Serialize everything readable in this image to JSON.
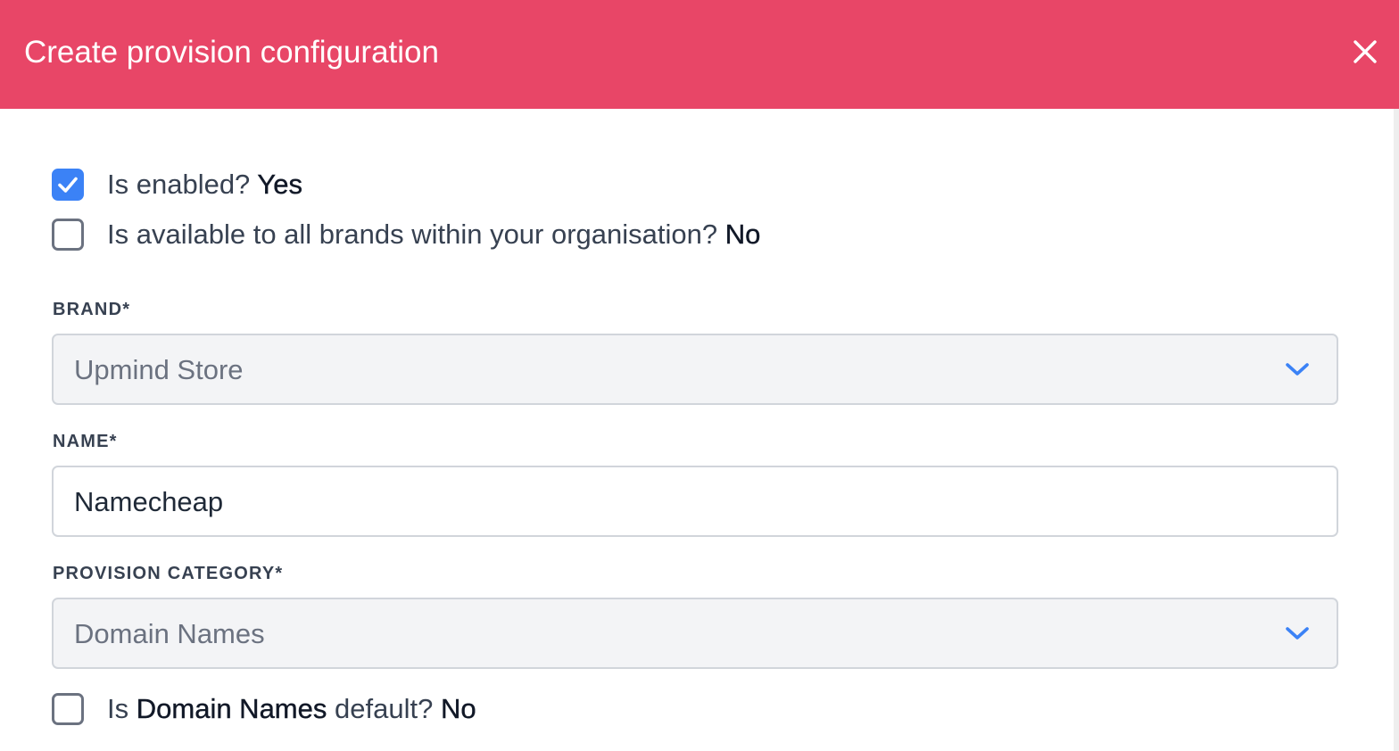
{
  "header": {
    "title": "Create provision configuration",
    "close_icon": "close-icon",
    "background_color": "#e84667"
  },
  "checkboxes": {
    "enabled": {
      "checked": true,
      "prefix": "Is enabled?",
      "value": "Yes"
    },
    "all_brands": {
      "checked": false,
      "prefix": "Is available to all brands within your organisation?",
      "value": "No"
    },
    "category_default": {
      "checked": false,
      "prefix": "Is",
      "category": "Domain Names",
      "middle": "default?",
      "value": "No"
    }
  },
  "fields": {
    "brand": {
      "label": "BRAND*",
      "value": "Upmind Store",
      "icon": "chevron-down-icon"
    },
    "name": {
      "label": "NAME*",
      "value": "Namecheap"
    },
    "provision_category": {
      "label": "PROVISION CATEGORY*",
      "value": "Domain Names",
      "icon": "chevron-down-icon"
    }
  },
  "colors": {
    "accent": "#3b82f6",
    "checkbox_border": "#6b7280",
    "select_background": "#f3f4f6"
  }
}
